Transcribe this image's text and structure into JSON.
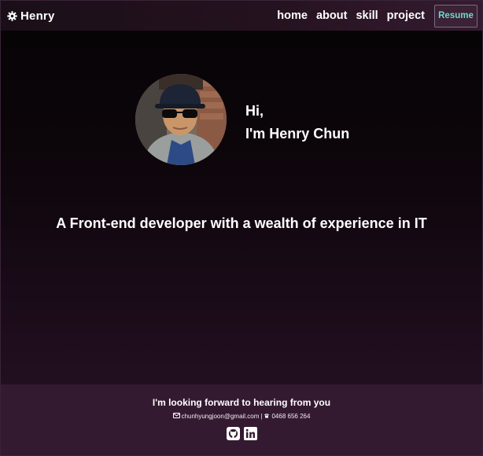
{
  "nav": {
    "brand_name": "Henry",
    "brand_icon": "gear-icon",
    "links": [
      "home",
      "about",
      "skill",
      "project"
    ],
    "resume_label": "Resume"
  },
  "hero": {
    "greeting_line1": "Hi,",
    "greeting_line2": "I'm Henry Chun",
    "tagline": "A Front-end developer with a wealth of experience in IT"
  },
  "footer": {
    "title": "I'm looking forward to hearing from you",
    "email": "chunhyungjoon@gmail.com",
    "separator": "|",
    "phone": "0468 656 264",
    "social_icons": [
      "github-icon",
      "linkedin-icon"
    ]
  },
  "colors": {
    "resume_text": "#6fd7d0",
    "footer_bg": "#341a31",
    "nav_bg": "#24121f"
  }
}
